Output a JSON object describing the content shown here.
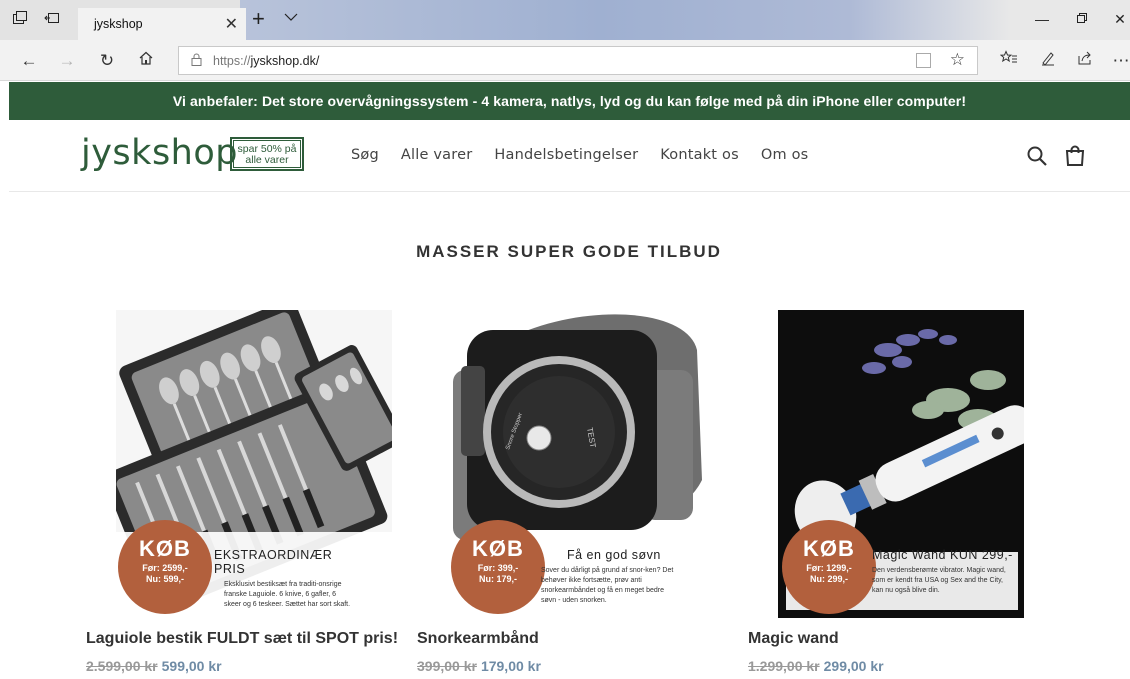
{
  "browser": {
    "tab_title": "jyskshop",
    "url_protocol": "https://",
    "url_host": "jyskshop.dk/"
  },
  "announcement": "Vi anbefaler: Det store overvågningssystem - 4 kamera, natlys, lyd og du kan følge med på din iPhone eller computer!",
  "header": {
    "logo": "jyskshop",
    "badge_line1": "spar 50% på",
    "badge_line2": "alle varer",
    "menu": [
      "Søg",
      "Alle varer",
      "Handelsbetingelser",
      "Kontakt os",
      "Om os"
    ]
  },
  "section_title": "MASSER SUPER GODE TILBUD",
  "products": [
    {
      "title": "Laguiole bestik FULDT sæt til SPOT pris!",
      "old_price": "2.599,00 kr",
      "new_price": "599,00 kr",
      "badge_buy": "KØB",
      "badge_before": "Før: 2599,-",
      "badge_now": "Nu:  599,-",
      "promo_heading": "EKSTRAORDINÆR PRIS",
      "promo_text": "Eksklusivt bestiksæt fra traditi-onsrige franske Laguiole. 6 knive, 6 gafler, 6 skeer og 6 teskeer. Sættet har sort skaft."
    },
    {
      "title": "Snorkearmbånd",
      "old_price": "399,00 kr",
      "new_price": "179,00 kr",
      "badge_buy": "KØB",
      "badge_before": "Før: 399,-",
      "badge_now": "Nu:  179,-",
      "promo_heading": "Få en god søvn",
      "promo_text": "Sover du dårligt på grund af snor-ken? Det behøver ikke fortsætte, prøv anti snorkearmbåndet og få en meget bedre søvn - uden snorken.",
      "device_label": "TEST",
      "device_brand": "Snore Stopper"
    },
    {
      "title": "Magic wand",
      "old_price": "1.299,00 kr",
      "new_price": "299,00 kr",
      "badge_buy": "KØB",
      "badge_before": "Før: 1299,-",
      "badge_now": "Nu:  299,-",
      "promo_heading": "Magic Wand KUN 299,-",
      "promo_text": "Den verdensberømte vibrator. Magic wand, som er kendt fra USA og Sex and the City, kan nu også blive din."
    }
  ],
  "colors": {
    "brand_green": "#2e5c3a",
    "badge_orange": "#b2603d",
    "sale_price": "#6f8ba5"
  }
}
